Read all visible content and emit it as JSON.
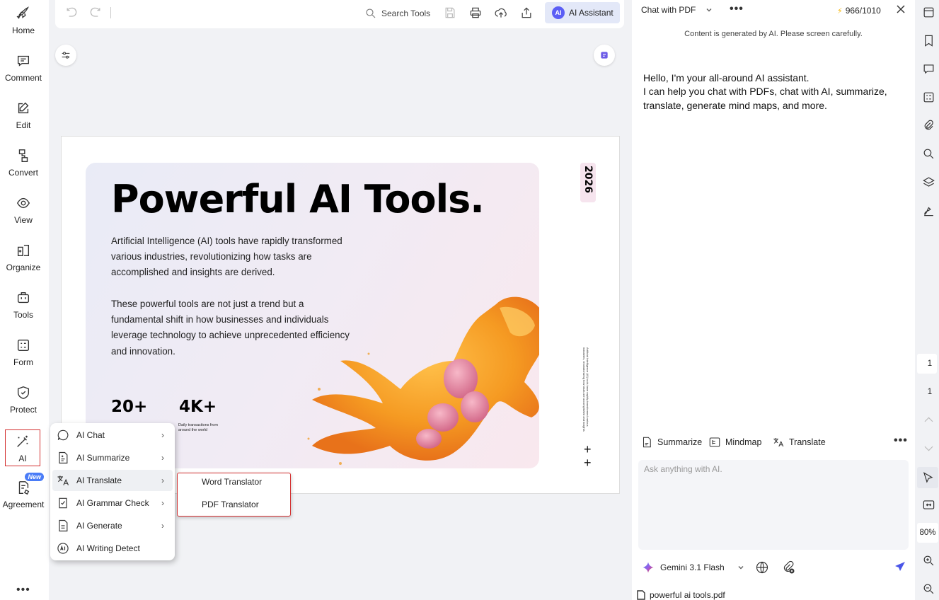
{
  "left_nav": {
    "items": [
      {
        "label": "Home",
        "icon": "rocket-icon"
      },
      {
        "label": "Comment",
        "icon": "comment-icon"
      },
      {
        "label": "Edit",
        "icon": "edit-icon"
      },
      {
        "label": "Convert",
        "icon": "convert-icon"
      },
      {
        "label": "View",
        "icon": "eye-icon"
      },
      {
        "label": "Organize",
        "icon": "organize-icon"
      },
      {
        "label": "Tools",
        "icon": "toolbox-icon"
      },
      {
        "label": "Form",
        "icon": "form-icon"
      },
      {
        "label": "Protect",
        "icon": "shield-icon"
      },
      {
        "label": "AI",
        "icon": "magic-wand-icon"
      },
      {
        "label": "Agreement",
        "icon": "agreement-icon"
      }
    ],
    "agreement_badge": "New",
    "active": "AI"
  },
  "toolbar": {
    "search_label": "Search Tools",
    "ai_badge": "AI",
    "ai_assistant_label": "AI Assistant"
  },
  "document": {
    "title": "Powerful AI Tools.",
    "para1": "Artificial Intelligence (AI) tools have rapidly transformed various industries, revolutionizing how tasks are accomplished and insights are derived.",
    "para2": "These powerful tools are not just a trend but a fundamental shift in how businesses and individuals leverage technology to achieve unprecedented efficiency and innovation.",
    "stat1_value": "20+",
    "stat2_value": "4K+",
    "stat2_caption": "Daily transactions from around the world",
    "year": "2026",
    "plus": "+"
  },
  "ai_menu": {
    "items": [
      {
        "label": "AI Chat",
        "icon": "ai-chat-icon",
        "arrow": "›"
      },
      {
        "label": "AI Summarize",
        "icon": "ai-summarize-icon",
        "arrow": "›"
      },
      {
        "label": "AI Translate",
        "icon": "ai-translate-icon",
        "arrow": "›"
      },
      {
        "label": "AI Grammar Check",
        "icon": "ai-grammar-icon",
        "arrow": "›"
      },
      {
        "label": "AI Generate",
        "icon": "ai-generate-icon",
        "arrow": "›"
      },
      {
        "label": "AI Writing Detect",
        "icon": "ai-detect-icon",
        "arrow": ""
      }
    ],
    "hovered": "AI Translate",
    "submenu": [
      "Word Translator",
      "PDF Translator"
    ]
  },
  "ai_panel": {
    "mode": "Chat with PDF",
    "credits": "966/1010",
    "notice": "Content is generated by AI. Please screen carefully.",
    "greeting_line1": "Hello, I'm your all-around AI assistant.",
    "greeting_line2": "I can help you chat with PDFs, chat with AI, summarize, translate, generate mind maps, and more.",
    "quick_actions": [
      "Summarize",
      "Mindmap",
      "Translate"
    ],
    "input_placeholder": "Ask anything with AI.",
    "model": "Gemini 3.1 Flash",
    "file_name": "powerful ai tools.pdf"
  },
  "right_rail": {
    "page_current": "1",
    "page_total": "1",
    "zoom": "80%"
  },
  "colors": {
    "accent": "#5b5ef5",
    "highlight_border": "#d32f2f",
    "send": "#4a55e8"
  }
}
